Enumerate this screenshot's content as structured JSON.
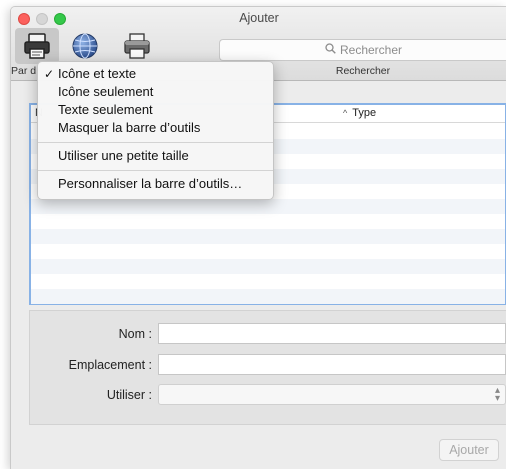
{
  "window": {
    "title": "Ajouter"
  },
  "toolbar": {
    "buttons": [
      {
        "id": "default",
        "icon": "default-printer-icon",
        "selected": true
      },
      {
        "id": "ip",
        "icon": "network-globe-icon",
        "selected": false
      },
      {
        "id": "windows",
        "icon": "windows-printer-icon",
        "selected": false
      }
    ],
    "left_label": "Par d",
    "search": {
      "placeholder": "Rechercher",
      "label": "Rechercher"
    }
  },
  "context_menu": {
    "items": [
      {
        "label": "Icône et texte",
        "checked": true,
        "check_mark": "✓"
      },
      {
        "label": "Icône seulement",
        "checked": false
      },
      {
        "label": "Texte seulement",
        "checked": false
      },
      {
        "label": "Masquer la barre d’outils",
        "checked": false
      }
    ],
    "size_item": "Utiliser une petite taille",
    "customize_item": "Personnaliser la barre d’outils…"
  },
  "printer_list": {
    "columns": [
      {
        "label": "N"
      },
      {
        "label": "Type",
        "sort_indicator": "^"
      }
    ],
    "rows": []
  },
  "form": {
    "name_label": "Nom :",
    "name_value": "",
    "location_label": "Emplacement :",
    "location_value": "",
    "use_label": "Utiliser :",
    "use_value": ""
  },
  "add_button": {
    "label": "Ajouter",
    "enabled": false
  },
  "colors": {
    "focus_ring": "#88b2e6",
    "close": "#fc615d",
    "minimize_disabled": "#d6d6d6",
    "zoom": "#34c84a"
  }
}
